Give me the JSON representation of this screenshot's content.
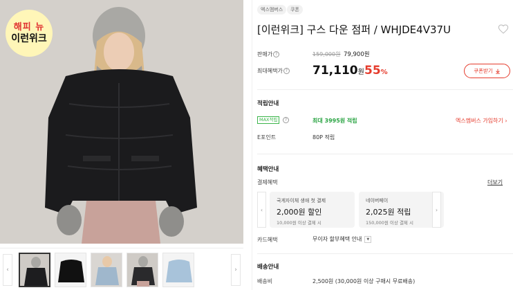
{
  "image": {
    "badge_line1": "해피 뉴",
    "badge_line2": "이런위크"
  },
  "thumbnails": [
    {
      "name": "thumb-1",
      "active": true
    },
    {
      "name": "thumb-2",
      "active": false
    },
    {
      "name": "thumb-3",
      "active": false
    },
    {
      "name": "thumb-4",
      "active": false
    },
    {
      "name": "thumb-5",
      "active": false
    }
  ],
  "thumb_prev": "‹",
  "thumb_next": "›",
  "tags": [
    "엑스멤버스",
    "쿠폰"
  ],
  "product": {
    "title": "[이런위크] 구스 다운 점퍼 / WHJDE4V37U"
  },
  "price": {
    "sale_label": "판매가",
    "info_icon": "?",
    "original": "159,000원",
    "sale": "79,900원",
    "max_label": "최대혜택가",
    "max_price": "71,110",
    "won": "원",
    "discount": "55",
    "pct_sign": "%",
    "coupon_button": "쿠폰받기"
  },
  "points": {
    "section_title": "적립안내",
    "max_badge": "MAX적립",
    "max_text": "최대 3995원 적립",
    "join_link": "엑스멤버스 가입하기",
    "epoint_label": "E포인트",
    "epoint_value": "80P 적립"
  },
  "benefits": {
    "section_title": "혜택안내",
    "payment_label": "결제혜택",
    "more_link": "더보기",
    "cards": [
      {
        "line1": "국게자이체 생애 첫 결제",
        "line2": "2,000원 할인",
        "line3": "10,000원 이상 결제 시"
      },
      {
        "line1": "네이버페이",
        "line2": "2,025원 적립",
        "line3": "150,000원 이상 결제 시"
      }
    ],
    "card_label": "카드혜택",
    "card_dropdown": "무이자 할부혜택 안내"
  },
  "shipping": {
    "section_title": "배송안내",
    "fee_label": "배송비",
    "fee_value": "2,500원 (30,000원 이상 구매시 무료배송)"
  },
  "colors": {
    "accent_red": "#e53b2c",
    "point_green": "#2aa443"
  }
}
